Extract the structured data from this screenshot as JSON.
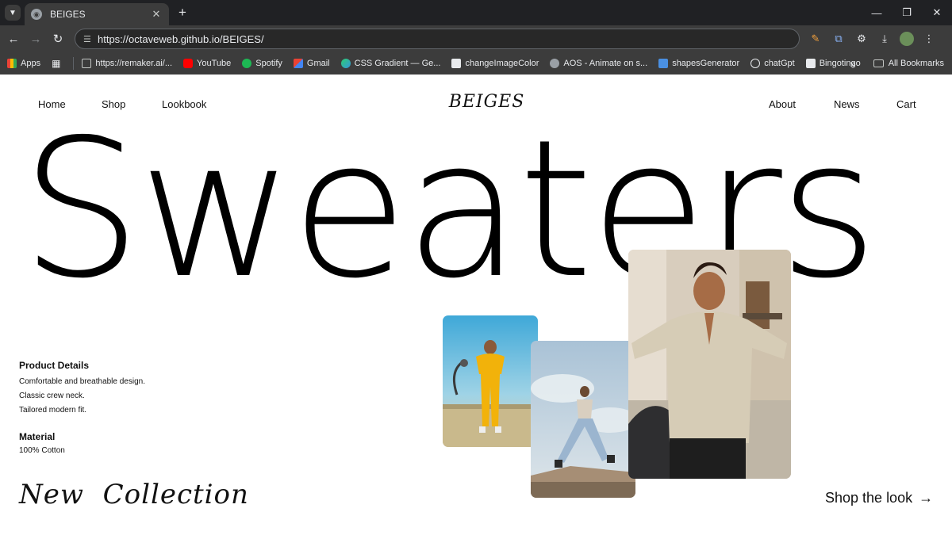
{
  "browser": {
    "tab_title": "BEIGES",
    "url": "https://octaveweb.github.io/BEIGES/",
    "bookmarks": [
      {
        "label": "Apps",
        "icon": "apps-grid-icon",
        "color": "#ea4335"
      },
      {
        "label": "https://remaker.ai/...",
        "icon": "folder-icon",
        "color": "#c4c7c5"
      },
      {
        "label": "YouTube",
        "icon": "youtube-icon",
        "color": "#ff0000"
      },
      {
        "label": "Spotify",
        "icon": "spotify-icon",
        "color": "#1db954"
      },
      {
        "label": "Gmail",
        "icon": "gmail-icon",
        "color": "#ea4335"
      },
      {
        "label": "CSS Gradient — Ge...",
        "icon": "css-gradient-icon",
        "color": "#2ecc71"
      },
      {
        "label": "changeImageColor",
        "icon": "change-image-color-icon",
        "color": "#e8eaed"
      },
      {
        "label": "AOS - Animate on s...",
        "icon": "aos-icon",
        "color": "#9aa0a6"
      },
      {
        "label": "shapesGenerator",
        "icon": "shapes-generator-icon",
        "color": "#4a90e2"
      },
      {
        "label": "chatGpt",
        "icon": "chatgpt-icon",
        "color": "#e8eaed"
      },
      {
        "label": "Bingotingo",
        "icon": "bingotingo-icon",
        "color": "#e8eaed"
      }
    ],
    "all_bookmarks": "All Bookmarks"
  },
  "nav": {
    "home": "Home",
    "shop": "Shop",
    "lookbook": "Lookbook",
    "brand": "BEIGES",
    "about": "About",
    "news": "News",
    "cart": "Cart"
  },
  "hero": {
    "word": "Sweaters"
  },
  "details": {
    "title": "Product Details",
    "lines": [
      "Comfortable and breathable design.",
      "Classic crew neck.",
      "Tailored modern fit."
    ]
  },
  "material": {
    "title": "Material",
    "value": "100% Cotton"
  },
  "footer": {
    "collection": "New  Collection",
    "shop_look": "Shop the look"
  }
}
